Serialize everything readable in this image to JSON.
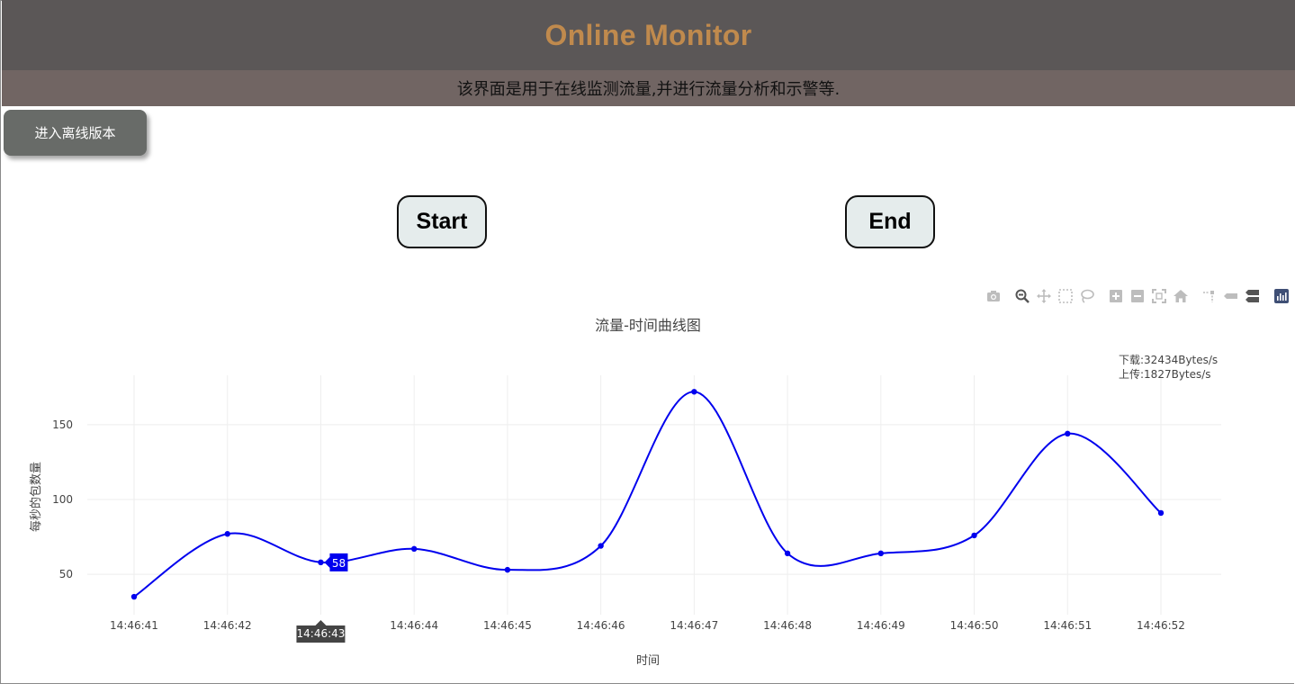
{
  "header": {
    "title": "Online Monitor",
    "subtitle": "该界面是用于在线监测流量,并进行流量分析和示警等."
  },
  "buttons": {
    "offline": "进入离线版本",
    "start": "Start",
    "end": "End"
  },
  "modebar": {
    "icons": [
      "camera-icon",
      "zoom-icon",
      "pan-icon",
      "box-select-icon",
      "lasso-select-icon",
      "zoom-in-icon",
      "zoom-out-icon",
      "autoscale-icon",
      "reset-axes-icon",
      "spike-lines-icon",
      "hover-closest-icon",
      "hover-compare-icon",
      "plotly-logo-icon"
    ]
  },
  "chart_data": {
    "type": "line",
    "title": "流量-时间曲线图",
    "xlabel": "时间",
    "ylabel": "每秒的包数量",
    "categories": [
      "14:46:41",
      "14:46:42",
      "14:46:43",
      "14:46:44",
      "14:46:45",
      "14:46:46",
      "14:46:47",
      "14:46:48",
      "14:46:49",
      "14:46:50",
      "14:46:51",
      "14:46:52"
    ],
    "series": [
      {
        "values": [
          35,
          77,
          58,
          67,
          53,
          69,
          172,
          64,
          64,
          76,
          144,
          91
        ],
        "color": "#0000ee"
      }
    ],
    "yticks": [
      50,
      100,
      150
    ],
    "ylim": [
      23,
      183
    ],
    "grid": true,
    "annotation": {
      "lines": [
        "下载:32434Bytes/s",
        "上传:1827Bytes/s"
      ],
      "placement": "top-right"
    },
    "hover": {
      "index": 2,
      "x_label": "14:46:43",
      "y_label": "58"
    }
  }
}
